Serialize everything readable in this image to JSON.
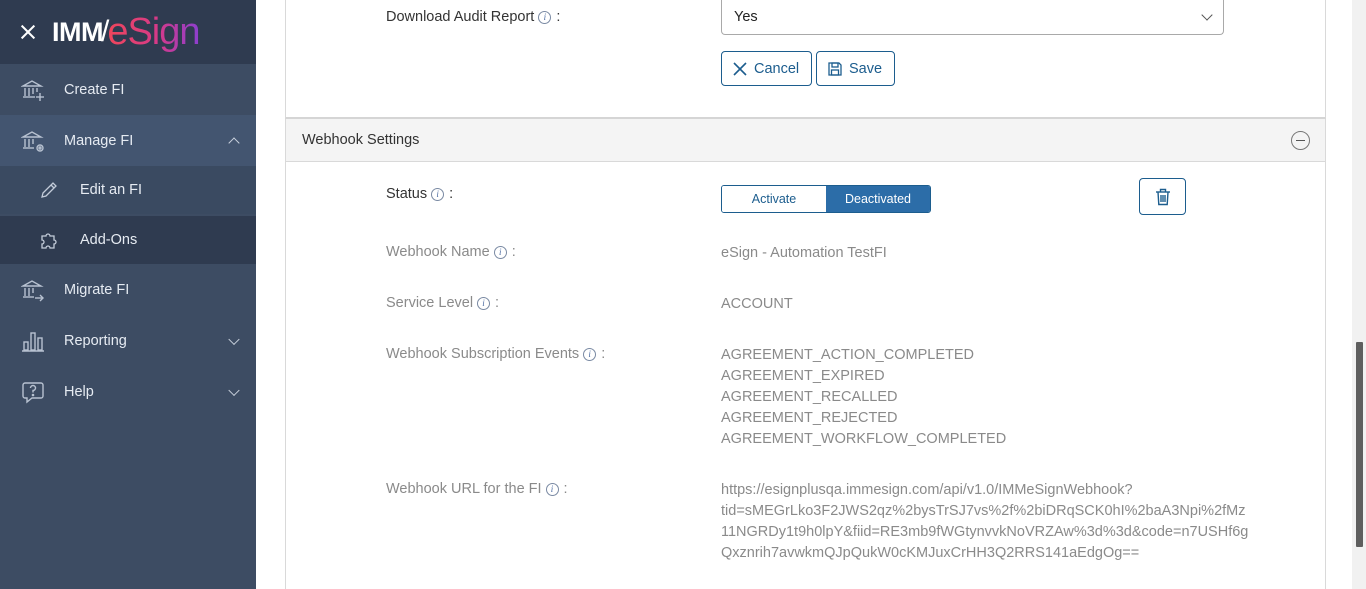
{
  "brand": {
    "imm": "IMM",
    "slash": "/",
    "esign": "eSign"
  },
  "sidebar": {
    "items": [
      {
        "label": "Create FI",
        "icon": "bank-plus-icon"
      },
      {
        "label": "Manage FI",
        "icon": "bank-gear-icon",
        "expanded": true,
        "children": [
          {
            "label": "Edit an FI",
            "icon": "pencil-icon",
            "selected": true
          },
          {
            "label": "Add-Ons",
            "icon": "puzzle-icon"
          }
        ]
      },
      {
        "label": "Migrate FI",
        "icon": "bank-arrow-icon"
      },
      {
        "label": "Reporting",
        "icon": "bar-chart-icon",
        "expandable": true
      },
      {
        "label": "Help",
        "icon": "help-bubble-icon",
        "expandable": true
      }
    ]
  },
  "form": {
    "download_audit_label": "Download Audit Report",
    "download_audit_value": "Yes",
    "colon": ":",
    "cancel_label": "Cancel",
    "save_label": "Save"
  },
  "webhook": {
    "section_title": "Webhook Settings",
    "status_label": "Status",
    "activate_label": "Activate",
    "deactivated_label": "Deactivated",
    "status_selected": "Deactivated",
    "name_label": "Webhook Name",
    "name_value": "eSign - Automation TestFI",
    "service_level_label": "Service Level",
    "service_level_value": "ACCOUNT",
    "events_label": "Webhook Subscription Events",
    "events": [
      "AGREEMENT_ACTION_COMPLETED",
      "AGREEMENT_EXPIRED",
      "AGREEMENT_RECALLED",
      "AGREEMENT_REJECTED",
      "AGREEMENT_WORKFLOW_COMPLETED"
    ],
    "url_label": "Webhook URL for the FI",
    "url_lines": [
      "https://esignplusqa.immesign.com/api/v1.0/IMMeSignWebhook?",
      "tid=sMEGrLko3F2JWS2qz%2bysTrSJ7vs%2f%2biDRqSCK0hI%2baA3Npi%2fMz",
      "11NGRDy1t9h0lpY&fiid=RE3mb9fWGtynvvkNoVRZAw%3d%3d&code=n7USHf6g",
      "Qxznrih7avwkmQJpQukW0cKMJuxCrHH3Q2RRS141aEdgOg=="
    ]
  },
  "colors": {
    "sidebar": "#3d4c63",
    "sidebar_dark": "#2f3b50",
    "accent": "#1c5d8e",
    "toggle_active": "#2c6da8"
  }
}
